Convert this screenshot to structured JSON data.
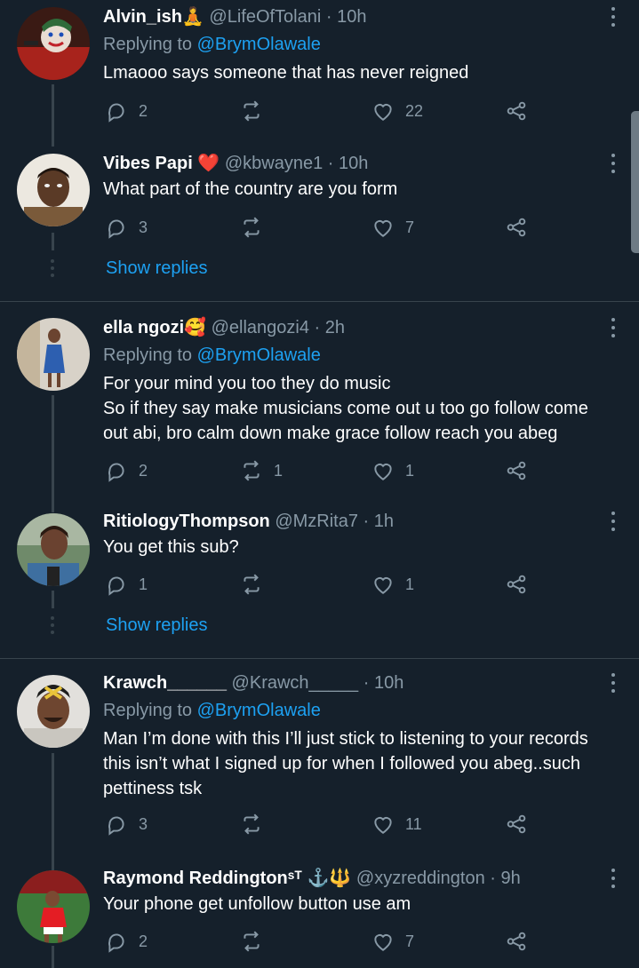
{
  "colors": {
    "background": "#15202b",
    "secondary": "#8899a6",
    "accent": "#1da1f2",
    "line": "#38444d"
  },
  "icons": {
    "reply": "reply-icon",
    "retweet": "retweet-icon",
    "like": "heart-icon",
    "share": "share-icon",
    "more": "more-options-icon"
  },
  "tweets": [
    {
      "name": "Alvin_ish",
      "emoji": "🧘",
      "handle": "@LifeOfTolani",
      "sep": "·",
      "time": "10h",
      "reply_prefix": "Replying to",
      "reply_mention": "@BrymOlawale",
      "text": "Lmaooo says someone that has never reigned",
      "replies": "2",
      "retweets": "",
      "likes": "22"
    },
    {
      "name": "Vibes Papi",
      "emoji": "❤️",
      "handle": "@kbwayne1",
      "sep": "·",
      "time": "10h",
      "text": "What part of the country are you form",
      "replies": "3",
      "retweets": "",
      "likes": "7"
    },
    {
      "name": "ella ngozi",
      "emoji": "🥰",
      "handle": "@ellangozi4",
      "sep": "·",
      "time": "2h",
      "reply_prefix": "Replying to",
      "reply_mention": "@BrymOlawale",
      "text": "For your mind you too they do music\nSo if they say make musicians come out u too go follow come out abi, bro calm down make grace follow reach you abeg",
      "replies": "2",
      "retweets": "1",
      "likes": "1"
    },
    {
      "name": "RitiologyThompson",
      "emoji": "",
      "handle": "@MzRita7",
      "sep": "·",
      "time": "1h",
      "text": "You get this sub?",
      "replies": "1",
      "retweets": "",
      "likes": "1"
    },
    {
      "name": "Krawch______",
      "emoji": "",
      "handle": "@Krawch_____",
      "sep": "·",
      "time": "10h",
      "reply_prefix": "Replying to",
      "reply_mention": "@BrymOlawale",
      "text": "Man I’m done with this I’ll just stick to listening to your records this isn’t what I signed up for when I followed you abeg..such pettiness tsk",
      "replies": "3",
      "retweets": "",
      "likes": "11"
    },
    {
      "name": "Raymond Reddingtonˢᵀ",
      "emoji": "⚓🔱",
      "handle": "@xyzreddington",
      "sep": "·",
      "time": "9h",
      "text": "Your phone get unfollow button use am",
      "replies": "2",
      "retweets": "",
      "likes": "7"
    }
  ],
  "show_replies": "Show replies"
}
